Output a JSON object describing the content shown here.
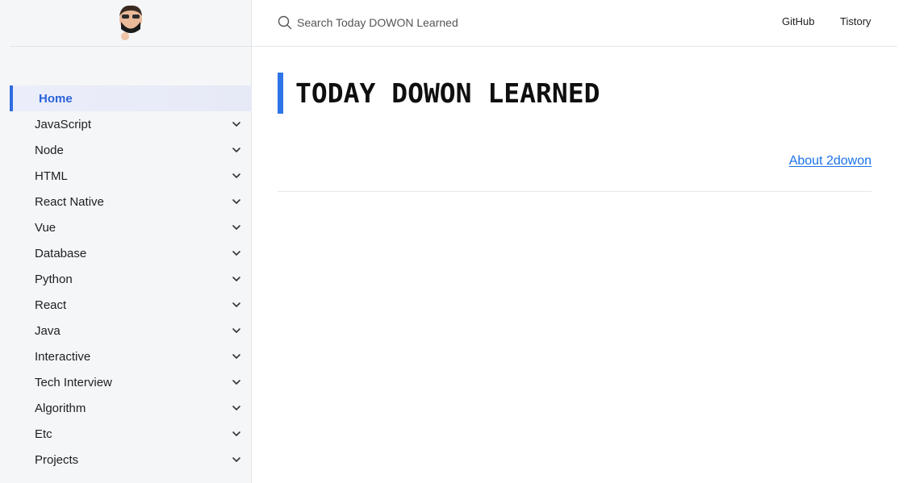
{
  "search": {
    "placeholder": "Search Today DOWON Learned"
  },
  "topnav": {
    "github": "GitHub",
    "tistory": "Tistory"
  },
  "sidebar": {
    "items": [
      {
        "label": "Home",
        "active": true
      },
      {
        "label": "JavaScript"
      },
      {
        "label": "Node"
      },
      {
        "label": "HTML"
      },
      {
        "label": "React Native"
      },
      {
        "label": "Vue"
      },
      {
        "label": "Database"
      },
      {
        "label": "Python"
      },
      {
        "label": "React"
      },
      {
        "label": "Java"
      },
      {
        "label": "Interactive"
      },
      {
        "label": "Tech Interview"
      },
      {
        "label": "Algorithm"
      },
      {
        "label": "Etc"
      },
      {
        "label": "Projects"
      }
    ]
  },
  "main": {
    "title": "TODAY DOWON LEARNED",
    "about_link": "About 2dowon"
  },
  "colors": {
    "accent": "#2f6be0",
    "link": "#1a73e8",
    "sidebar_bg": "#f5f6f7"
  }
}
